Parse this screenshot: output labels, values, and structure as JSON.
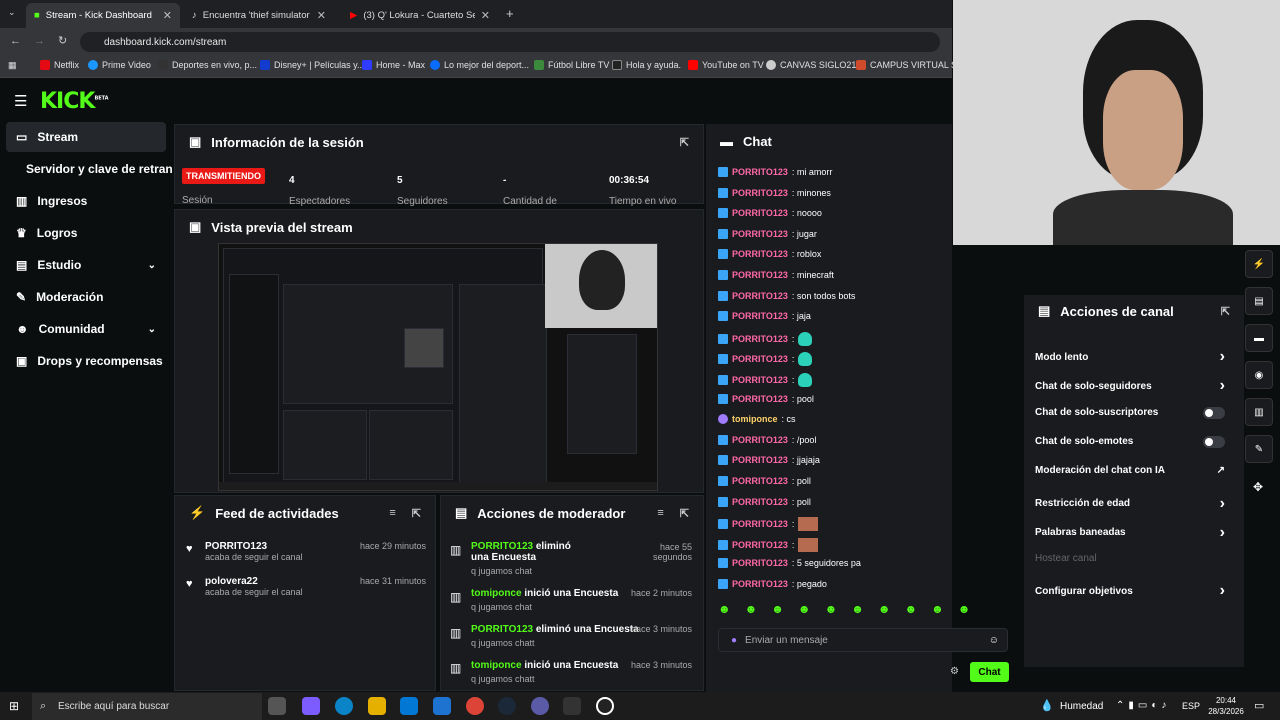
{
  "browser": {
    "tabs": [
      {
        "label": "Stream - Kick Dashboard",
        "active": true
      },
      {
        "label": "Encuentra 'thief simulator mult",
        "active": false
      },
      {
        "label": "(3) Q' Lokura - Cuarteto Se",
        "active": false
      }
    ],
    "url": "dashboard.kick.com/stream",
    "bookmarks": [
      "Netflix",
      "Prime Video",
      "Deportes en vivo, p...",
      "Disney+ | Películas y...",
      "Home - Max",
      "Lo mejor del deport...",
      "Fútbol Libre TV",
      "Hola y ayuda.",
      "YouTube on TV",
      "CANVAS SIGLO21",
      "CAMPUS VIRTUAL S..."
    ]
  },
  "app": {
    "logo": "KICK",
    "beta": "BETA"
  },
  "sidebar": {
    "items": [
      {
        "label": "Stream"
      },
      {
        "label": "Servidor y clave de retransm"
      },
      {
        "label": "Ingresos"
      },
      {
        "label": "Logros"
      },
      {
        "label": "Estudio"
      },
      {
        "label": "Moderación"
      },
      {
        "label": "Comunidad"
      },
      {
        "label": "Drops y recompensas"
      }
    ]
  },
  "session": {
    "title": "Información de la sesión",
    "status": "TRANSMITIENDO",
    "session_label": "Sesión",
    "stats": [
      {
        "value": "4",
        "label": "Espectadores"
      },
      {
        "value": "5",
        "label": "Seguidores"
      },
      {
        "value": "-",
        "label": "Cantidad de"
      },
      {
        "value": "00:36:54",
        "label": "Tiempo en vivo"
      }
    ]
  },
  "preview": {
    "title": "Vista previa del stream"
  },
  "feed": {
    "title": "Feed de actividades",
    "items": [
      {
        "user": "PORRITO123",
        "text": "acaba de seguir el canal",
        "time": "hace 29 minutos"
      },
      {
        "user": "polovera22",
        "text": "acaba de seguir el canal",
        "time": "hace 31 minutos"
      }
    ]
  },
  "mod": {
    "title": "Acciones de moderador",
    "items": [
      {
        "user": "PORRITO123",
        "action": "eliminó una Encuesta",
        "sub": "q jugamos chat",
        "time": "hace 55 segundos"
      },
      {
        "user": "tomiponce",
        "action": "inició una Encuesta",
        "sub": "q jugamos chat",
        "time": "hace 2 minutos"
      },
      {
        "user": "PORRITO123",
        "action": "eliminó una Encuesta",
        "sub": "q jugamos chatt",
        "time": "hace 3 minutos"
      },
      {
        "user": "tomiponce",
        "action": "inició una Encuesta",
        "sub": "q jugamos chatt",
        "time": "hace 3 minutos"
      }
    ]
  },
  "chat": {
    "title": "Chat",
    "messages": [
      {
        "user": "PORRITO123",
        "text": ": mi amorr"
      },
      {
        "user": "PORRITO123",
        "text": ": minones"
      },
      {
        "user": "PORRITO123",
        "text": ": noooo"
      },
      {
        "user": "PORRITO123",
        "text": ": jugar"
      },
      {
        "user": "PORRITO123",
        "text": ": roblox"
      },
      {
        "user": "PORRITO123",
        "text": ": minecraft"
      },
      {
        "user": "PORRITO123",
        "text": ": son todos bots"
      },
      {
        "user": "PORRITO123",
        "text": ": jaja"
      },
      {
        "user": "PORRITO123",
        "text": ":",
        "emote": "em"
      },
      {
        "user": "PORRITO123",
        "text": ":",
        "emote": "em"
      },
      {
        "user": "PORRITO123",
        "text": ":",
        "emote": "em"
      },
      {
        "user": "PORRITO123",
        "text": ": pool"
      },
      {
        "user": "tomiponce",
        "text": ": cs"
      },
      {
        "user": "PORRITO123",
        "text": ": /pool"
      },
      {
        "user": "PORRITO123",
        "text": ": jjajaja"
      },
      {
        "user": "PORRITO123",
        "text": ": poll"
      },
      {
        "user": "PORRITO123",
        "text": ": poll"
      },
      {
        "user": "PORRITO123",
        "text": ":",
        "emote": "sq"
      },
      {
        "user": "PORRITO123",
        "text": ":",
        "emote": "sq"
      },
      {
        "user": "PORRITO123",
        "text": ": 5 seguidores pa"
      },
      {
        "user": "PORRITO123",
        "text": ": pegado"
      }
    ],
    "placeholder": "Enviar un mensaje",
    "send_label": "Chat"
  },
  "channel_actions": {
    "title": "Acciones de canal",
    "items": [
      {
        "label": "Modo lento",
        "type": "arrow"
      },
      {
        "label": "Chat de solo-seguidores",
        "type": "arrow"
      },
      {
        "label": "Chat de solo-suscriptores",
        "type": "toggle"
      },
      {
        "label": "Chat de solo-emotes",
        "type": "toggle"
      },
      {
        "label": "Moderación del chat con IA",
        "type": "link"
      },
      {
        "label": "Restricción de edad",
        "type": "arrow"
      },
      {
        "label": "Palabras baneadas",
        "type": "arrow"
      },
      {
        "label": "Hostear canal",
        "type": "disabled"
      },
      {
        "label": "Configurar objetivos",
        "type": "arrow"
      }
    ]
  },
  "taskbar": {
    "search_placeholder": "Escribe aquí para buscar",
    "weather": "Humedad",
    "lang": "ESP",
    "time": "20:44",
    "date": "28/3/2026"
  }
}
